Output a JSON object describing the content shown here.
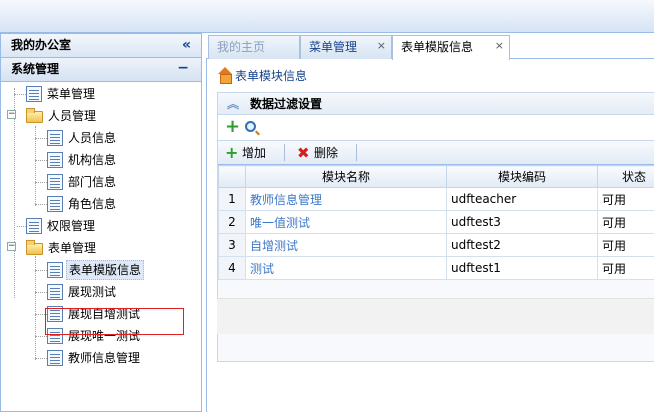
{
  "sidebar": {
    "title": "我的办公室",
    "collapse_icon": "«",
    "section": "系统管理",
    "section_toggle": "−",
    "tree": [
      {
        "label": "菜单管理"
      },
      {
        "label": "人员管理"
      },
      {
        "label": "人员信息"
      },
      {
        "label": "机构信息"
      },
      {
        "label": "部门信息"
      },
      {
        "label": "角色信息"
      },
      {
        "label": "权限管理"
      },
      {
        "label": "表单管理"
      },
      {
        "label": "表单模版信息"
      },
      {
        "label": "展现测试"
      },
      {
        "label": "展现自增测试"
      },
      {
        "label": "展现唯一测试"
      },
      {
        "label": "教师信息管理"
      }
    ]
  },
  "tabs": [
    {
      "label": "我的主页"
    },
    {
      "label": "菜单管理",
      "close": "×"
    },
    {
      "label": "表单模版信息",
      "close": "×"
    }
  ],
  "content": {
    "breadcrumb": "表单模块信息",
    "filter_title": "数据过滤设置",
    "toolbar": {
      "add_label": "增加",
      "delete_label": "删除"
    },
    "columns": [
      "模块名称",
      "模块编码",
      "状态"
    ],
    "rows": [
      {
        "n": "1",
        "name": "教师信息管理",
        "code": "udfteacher",
        "status": "可用"
      },
      {
        "n": "2",
        "name": "唯一值测试",
        "code": "udftest3",
        "status": "可用"
      },
      {
        "n": "3",
        "name": "自增测试",
        "code": "udftest2",
        "status": "可用"
      },
      {
        "n": "4",
        "name": "测试",
        "code": "udftest1",
        "status": "可用"
      }
    ]
  },
  "colors": {
    "accent": "#99bbe8",
    "link": "#3c78c8",
    "highlight_box": "#e02020"
  }
}
